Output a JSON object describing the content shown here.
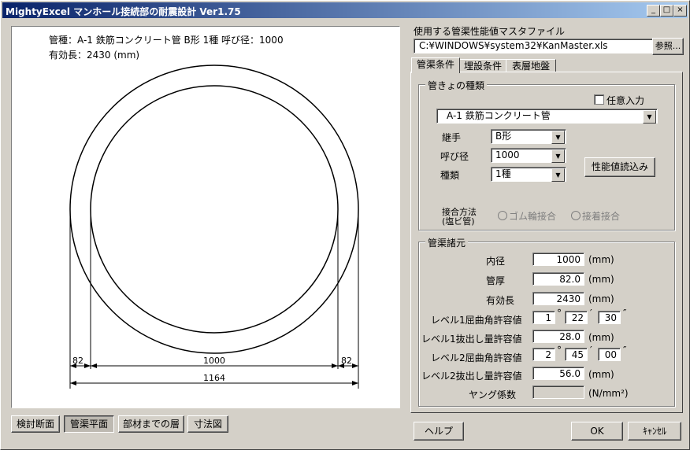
{
  "window": {
    "title": "MightyExcel マンホール接続部の耐震設計 Ver1.75",
    "min_label": "_",
    "max_label": "□",
    "close_label": "×"
  },
  "preview": {
    "pipe_type_line": "管種：A-1  鉄筋コンクリート管 B形 1種   呼び径：1000",
    "effective_length_line": "有効長：2430 (mm)",
    "dimensions": {
      "wall": "82",
      "inner": "1000",
      "outer": "1164"
    }
  },
  "view_buttons": [
    "検討断面",
    "管渠平面",
    "部材までの層",
    "寸法図"
  ],
  "master_file": {
    "label": "使用する管渠性能値マスタファイル",
    "path": "C:¥WINDOWS¥system32¥KanMaster.xls",
    "browse_label": "参照..."
  },
  "tabs": [
    "管渠条件",
    "埋設条件",
    "表層地盤"
  ],
  "pipe_kind": {
    "group_label": "管きょの種類",
    "manual_label": "任意入力",
    "pipe_select": "A-1  鉄筋コンクリート管",
    "joint_label": "継手",
    "joint_value": "B形",
    "diameter_label": "呼び径",
    "diameter_value": "1000",
    "class_label": "種類",
    "class_value": "1種",
    "read_button": "性能値読込み",
    "connect_label_1": "接合方法",
    "connect_label_2": "(塩ビ管)",
    "radio_rubber": "ゴム輪接合",
    "radio_adhesive": "接着接合"
  },
  "specs": {
    "group_label": "管渠諸元",
    "rows": [
      {
        "label": "内径",
        "value": "1000",
        "unit": "(mm)"
      },
      {
        "label": "管厚",
        "value": "82.0",
        "unit": "(mm)"
      },
      {
        "label": "有効長",
        "value": "2430",
        "unit": "(mm)"
      },
      {
        "label": "レベル1屈曲角許容値",
        "deg": "1",
        "min": "22",
        "sec": "30"
      },
      {
        "label": "レベル1抜出し量許容値",
        "value": "28.0",
        "unit": "(mm)"
      },
      {
        "label": "レベル2屈曲角許容値",
        "deg": "2",
        "min": "45",
        "sec": "00"
      },
      {
        "label": "レベル2抜出し量許容値",
        "value": "56.0",
        "unit": "(mm)"
      },
      {
        "label": "ヤング係数",
        "value": "",
        "unit": "(N/mm²)"
      }
    ],
    "deg_mark": "°",
    "min_mark": "′",
    "sec_mark": "″"
  },
  "footer": {
    "help": "ヘルプ",
    "ok": "OK",
    "cancel": "ｷｬﾝｾﾙ"
  }
}
